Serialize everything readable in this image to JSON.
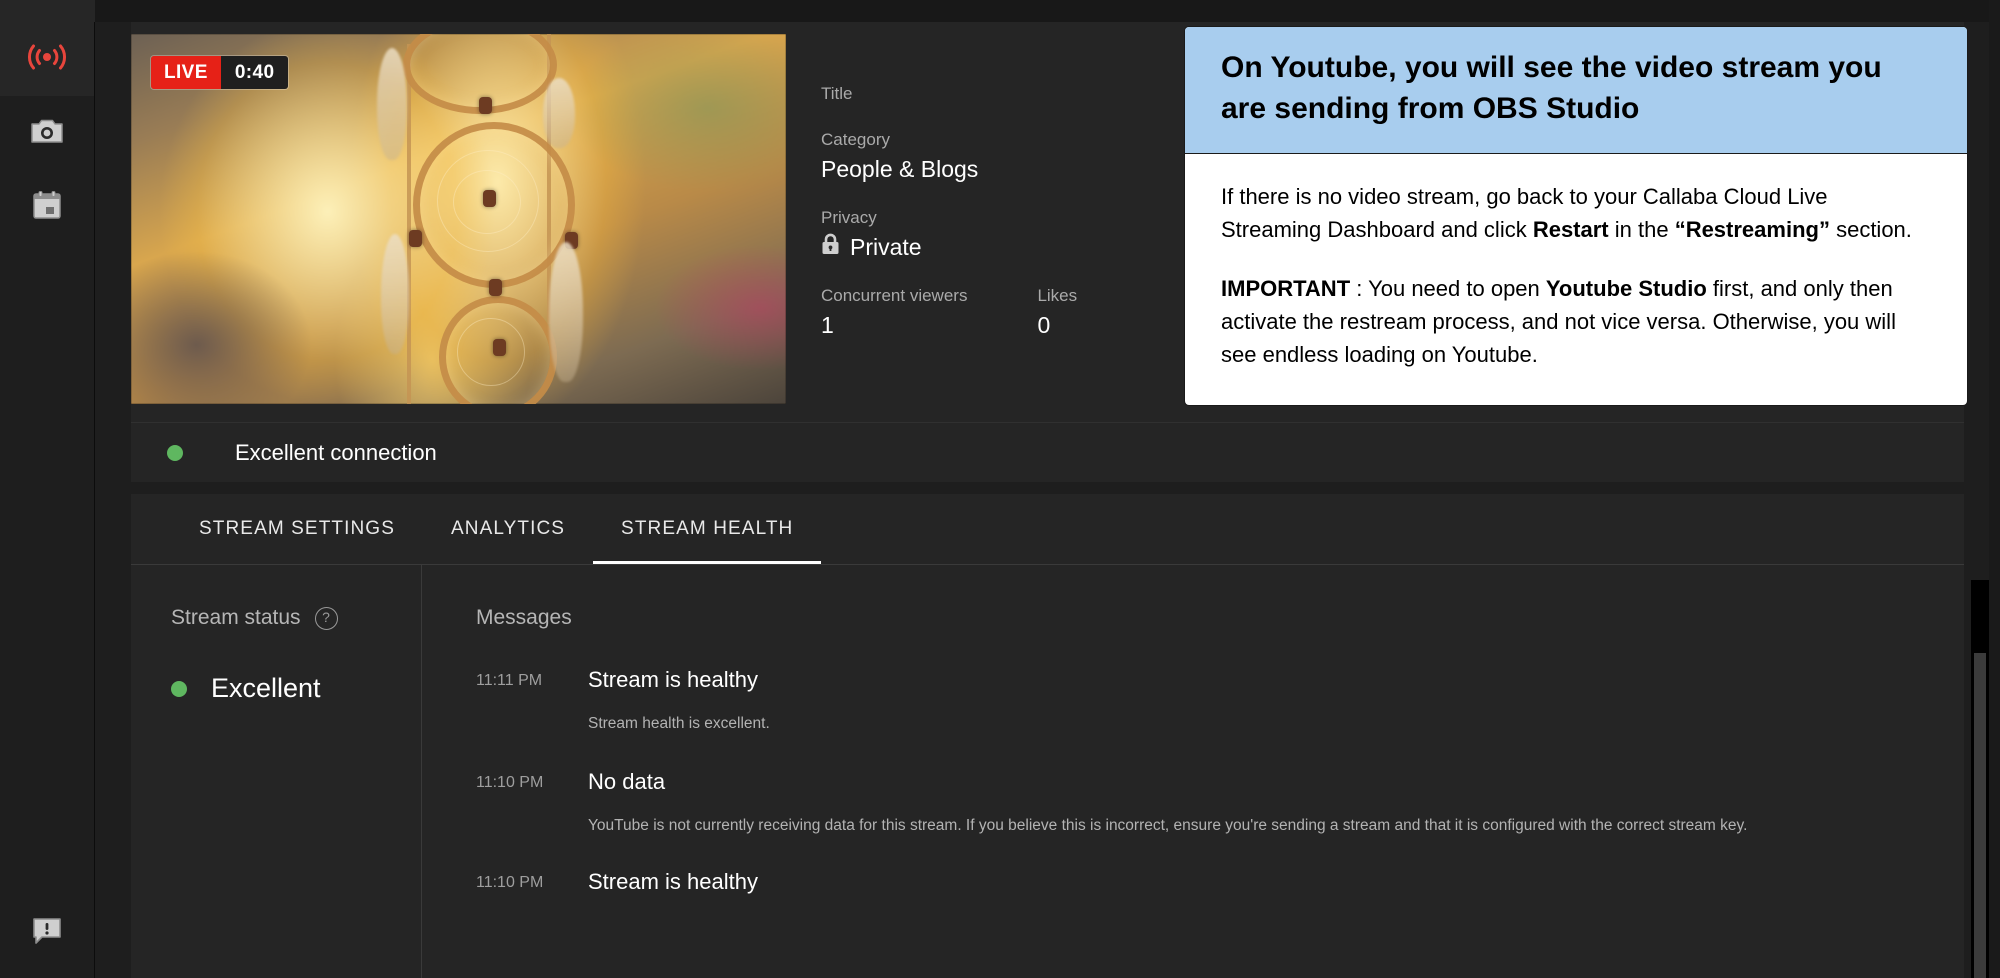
{
  "rail": {
    "items": [
      {
        "name": "live-streaming",
        "icon": "broadcast-icon",
        "active": true
      },
      {
        "name": "webcam",
        "icon": "camera-icon",
        "active": false
      },
      {
        "name": "schedule",
        "icon": "calendar-icon",
        "active": false
      }
    ],
    "feedback": {
      "name": "send-feedback",
      "icon": "feedback-icon"
    }
  },
  "hero": {
    "live_badge": {
      "label": "LIVE",
      "time": "0:40"
    },
    "meta": {
      "title_label": "Title",
      "title_value": "",
      "category_label": "Category",
      "category_value": "People & Blogs",
      "privacy_label": "Privacy",
      "privacy_value": "Private",
      "privacy_icon": "lock-icon",
      "viewers_label": "Concurrent viewers",
      "viewers_value": "1",
      "likes_label": "Likes",
      "likes_value": "0"
    },
    "connection": {
      "status_text": "Excellent connection",
      "status_color": "#5fb760"
    }
  },
  "tabs": [
    {
      "label": "STREAM SETTINGS",
      "active": false
    },
    {
      "label": "ANALYTICS",
      "active": false
    },
    {
      "label": "STREAM HEALTH",
      "active": true
    }
  ],
  "stream_health": {
    "status_column": {
      "heading": "Stream status",
      "help_glyph": "?",
      "value": "Excellent",
      "value_color": "#5fb760"
    },
    "messages_column": {
      "heading": "Messages",
      "items": [
        {
          "time": "11:11 PM",
          "title": "Stream is healthy",
          "description": "Stream health is excellent."
        },
        {
          "time": "11:10 PM",
          "title": "No data",
          "description": "YouTube is not currently receiving data for this stream. If you believe this is incorrect, ensure you're sending a stream and that it is configured with the correct stream key."
        },
        {
          "time": "11:10 PM",
          "title": "Stream is healthy",
          "description": ""
        }
      ]
    }
  },
  "callout": {
    "header": "On Youtube, you will see the video stream you are sending from OBS Studio",
    "paragraph1_part1": "If there is no video stream, go back to your Callaba Cloud Live Streaming Dashboard and click ",
    "paragraph1_bold1": "Restart",
    "paragraph1_part2": " in the ",
    "paragraph1_bold2": "“Restreaming”",
    "paragraph1_part3": " section.",
    "paragraph2_bold1": "IMPORTANT",
    "paragraph2_part1": " : You need to open ",
    "paragraph2_bold2": "Youtube Studio",
    "paragraph2_part2": " first, and only then activate the restream process, and not vice versa. Otherwise, you will see endless loading on Youtube.",
    "header_bg": "#a8cdee"
  }
}
